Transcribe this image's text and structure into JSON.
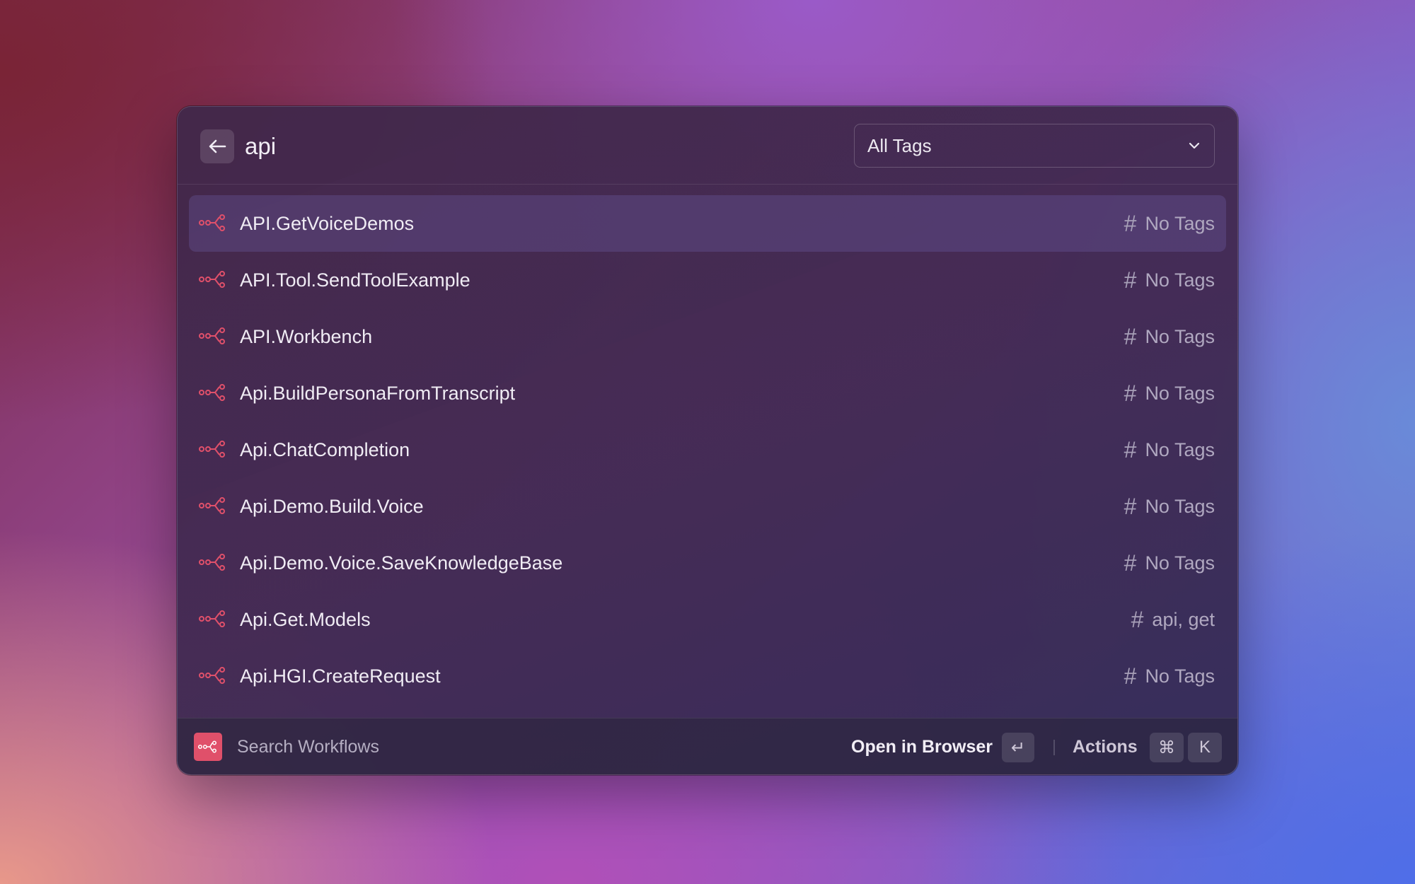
{
  "search": {
    "query": "api",
    "tag_filter": "All Tags"
  },
  "results": [
    {
      "name": "API.GetVoiceDemos",
      "tags": "No Tags",
      "selected": true
    },
    {
      "name": "API.Tool.SendToolExample",
      "tags": "No Tags"
    },
    {
      "name": "API.Workbench",
      "tags": "No Tags"
    },
    {
      "name": "Api.BuildPersonaFromTranscript",
      "tags": "No Tags"
    },
    {
      "name": "Api.ChatCompletion",
      "tags": "No Tags"
    },
    {
      "name": "Api.Demo.Build.Voice",
      "tags": "No Tags"
    },
    {
      "name": "Api.Demo.Voice.SaveKnowledgeBase",
      "tags": "No Tags"
    },
    {
      "name": "Api.Get.Models",
      "tags": "api, get"
    },
    {
      "name": "Api.HGI.CreateRequest",
      "tags": "No Tags"
    }
  ],
  "footer": {
    "title": "Search Workflows",
    "primary_action": "Open in Browser",
    "primary_key": "↵",
    "actions_label": "Actions",
    "actions_key_mod": "⌘",
    "actions_key": "K"
  },
  "icons": {
    "row": "workflow-icon",
    "hash": "hash-icon",
    "back": "arrow-left-icon",
    "dropdown": "chevron-down-icon"
  },
  "colors": {
    "accent": "#e0506a",
    "text_primary": "#f0ecf4",
    "text_secondary": "#b0a8c0"
  }
}
